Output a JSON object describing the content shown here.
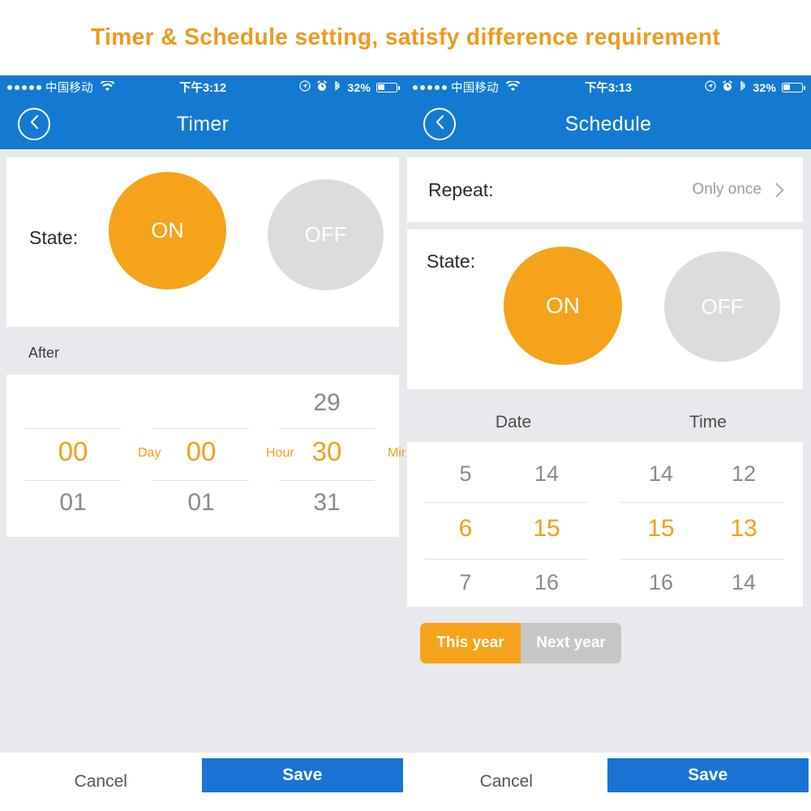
{
  "banner": {
    "title": "Timer & Schedule setting, satisfy difference requirement"
  },
  "accent": {
    "orange": "#F5A31B",
    "blue": "#1479D1",
    "save_blue": "#1A73D4",
    "gray": "#DCDCDC"
  },
  "timer": {
    "status": {
      "carrier": "中国移动",
      "signal_dots": 5,
      "wifi_icon": "wifi-icon",
      "time": "下午3:12",
      "location_icon": "location-icon",
      "alarm_icon": "alarm-icon",
      "bluetooth_icon": "bluetooth-icon",
      "battery_text": "32%",
      "battery_level": 32
    },
    "nav": {
      "back_icon": "chevron-left-icon",
      "title": "Timer"
    },
    "state": {
      "label": "State:",
      "on_label": "ON",
      "off_label": "OFF",
      "selected": "ON"
    },
    "after_label": "After",
    "picker": {
      "columns": [
        {
          "unit": "Day",
          "above": "",
          "selected": "00",
          "below": "01"
        },
        {
          "unit": "Hour",
          "above": "",
          "selected": "00",
          "below": "01"
        },
        {
          "unit": "Minute",
          "above": "29",
          "selected": "30",
          "below": "31"
        }
      ]
    },
    "footer": {
      "cancel": "Cancel",
      "save": "Save"
    }
  },
  "schedule": {
    "status": {
      "carrier": "中国移动",
      "signal_dots": 5,
      "wifi_icon": "wifi-icon",
      "time": "下午3:13",
      "location_icon": "location-icon",
      "alarm_icon": "alarm-icon",
      "bluetooth_icon": "bluetooth-icon",
      "battery_text": "32%",
      "battery_level": 32
    },
    "nav": {
      "back_icon": "chevron-left-icon",
      "title": "Schedule"
    },
    "repeat": {
      "label": "Repeat:",
      "value": "Only once",
      "chevron_icon": "chevron-right-icon"
    },
    "state": {
      "label": "State:",
      "on_label": "ON",
      "off_label": "OFF",
      "selected": "ON"
    },
    "picker_headers": {
      "date": "Date",
      "time": "Time"
    },
    "picker": {
      "columns": [
        {
          "above": "5",
          "selected": "6",
          "below": "7"
        },
        {
          "above": "14",
          "selected": "15",
          "below": "16"
        },
        {
          "above": "14",
          "selected": "15",
          "below": "16"
        },
        {
          "above": "12",
          "selected": "13",
          "below": "14"
        }
      ]
    },
    "year_toggle": {
      "this_year": "This year",
      "next_year": "Next year",
      "selected": "This year"
    },
    "footer": {
      "cancel": "Cancel",
      "save": "Save"
    }
  }
}
